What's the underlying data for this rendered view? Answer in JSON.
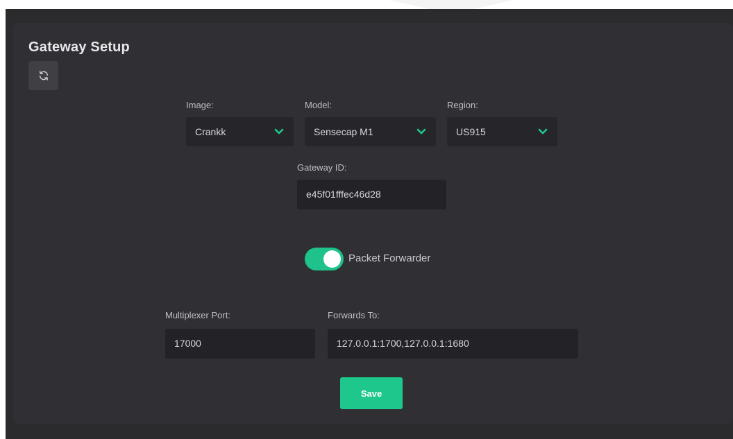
{
  "page": {
    "title": "Gateway Setup"
  },
  "icons": {
    "refresh": "refresh-icon",
    "chevron": "chevron-down-icon"
  },
  "form": {
    "image": {
      "label": "Image:",
      "value": "Crankk"
    },
    "model": {
      "label": "Model:",
      "value": "Sensecap M1"
    },
    "region": {
      "label": "Region:",
      "value": "US915"
    },
    "gateway_id": {
      "label": "Gateway ID:",
      "value": "e45f01fffec46d28"
    },
    "packet_forwarder": {
      "label": "Packet Forwarder",
      "enabled": true
    },
    "multiplexer_port": {
      "label": "Multiplexer Port:",
      "value": "17000"
    },
    "forwards_to": {
      "label": "Forwards To:",
      "value": "127.0.0.1:1700,127.0.0.1:1680"
    },
    "save_label": "Save"
  },
  "colors": {
    "accent": "#1ec88c",
    "card": "#303034",
    "field": "#26262a"
  }
}
